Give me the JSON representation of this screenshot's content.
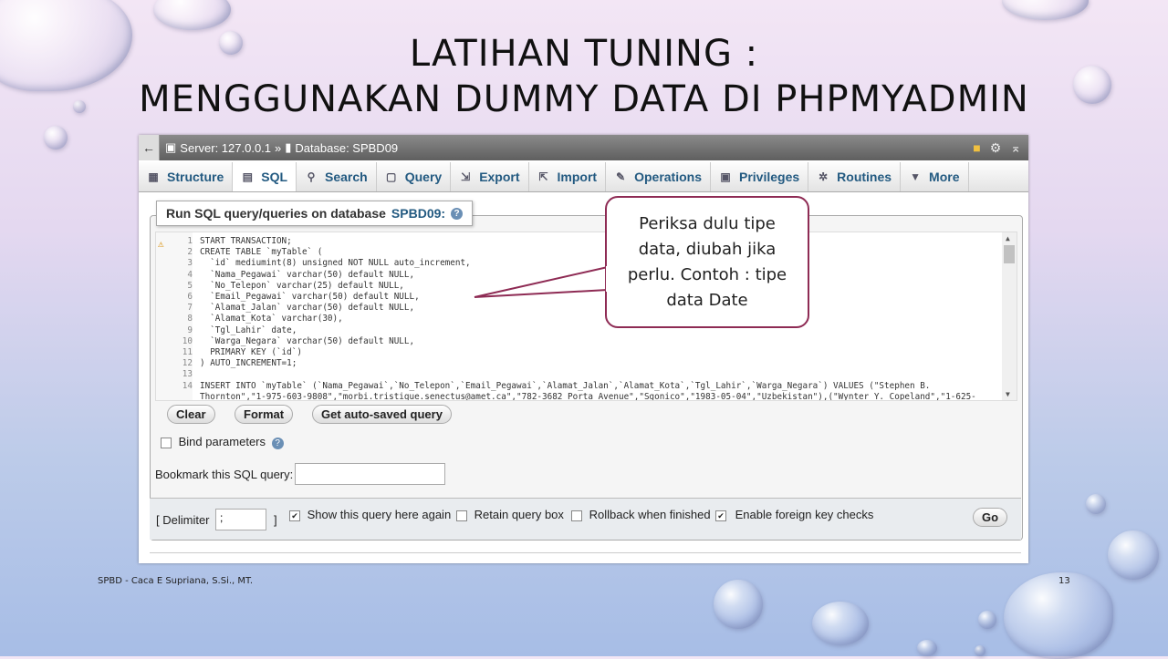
{
  "slide": {
    "title_line1": "LATIHAN TUNING :",
    "title_line2": "MENGGUNAKAN DUMMY DATA DI PHPMYADMIN",
    "footer_left": "SPBD - Caca E Supriana, S.Si., MT.",
    "page_number": "13"
  },
  "callout": {
    "line1": "Periksa dulu tipe",
    "line2": "data, diubah jika",
    "line3": "perlu. Contoh : tipe",
    "line4": "data Date"
  },
  "topbar": {
    "back": "←",
    "server": "Server: 127.0.0.1",
    "separator": "»",
    "database": "Database: SPBD09"
  },
  "tabs": [
    {
      "label": "Structure",
      "icon": "structure-icon"
    },
    {
      "label": "SQL",
      "icon": "sql-icon"
    },
    {
      "label": "Search",
      "icon": "search-icon"
    },
    {
      "label": "Query",
      "icon": "query-icon"
    },
    {
      "label": "Export",
      "icon": "export-icon"
    },
    {
      "label": "Import",
      "icon": "import-icon"
    },
    {
      "label": "Operations",
      "icon": "wrench-icon"
    },
    {
      "label": "Privileges",
      "icon": "privileges-icon"
    },
    {
      "label": "Routines",
      "icon": "routines-icon"
    },
    {
      "label": "More",
      "icon": "caret-down-icon"
    }
  ],
  "active_tab": "SQL",
  "sql_panel": {
    "legend_prefix": "Run SQL query/queries on database",
    "legend_db": "SPBD09:",
    "help": "?"
  },
  "editor_lines": [
    {
      "n": "1",
      "code": "START TRANSACTION;"
    },
    {
      "n": "2",
      "code": "CREATE TABLE `myTable` ("
    },
    {
      "n": "3",
      "code": "  `id` mediumint(8) unsigned NOT NULL auto_increment,"
    },
    {
      "n": "4",
      "code": "  `Nama_Pegawai` varchar(50) default NULL,"
    },
    {
      "n": "5",
      "code": "  `No_Telepon` varchar(25) default NULL,"
    },
    {
      "n": "6",
      "code": "  `Email_Pegawai` varchar(50) default NULL,"
    },
    {
      "n": "7",
      "code": "  `Alamat_Jalan` varchar(50) default NULL,"
    },
    {
      "n": "8",
      "code": "  `Alamat_Kota` varchar(30),"
    },
    {
      "n": "9",
      "code": "  `Tgl_Lahir` date,"
    },
    {
      "n": "10",
      "code": "  `Warga_Negara` varchar(50) default NULL,"
    },
    {
      "n": "11",
      "code": "  PRIMARY KEY (`id`)"
    },
    {
      "n": "12",
      "code": ") AUTO_INCREMENT=1;"
    },
    {
      "n": "13",
      "code": ""
    },
    {
      "n": "14",
      "code": "INSERT INTO `myTable` (`Nama_Pegawai`,`No_Telepon`,`Email_Pegawai`,`Alamat_Jalan`,`Alamat_Kota`,`Tgl_Lahir`,`Warga_Negara`) VALUES (\"Stephen B."
    },
    {
      "n": "",
      "code": "Thornton\",\"1-975-603-9808\",\"morbi.tristique.senectus@amet.ca\",\"782-3682 Porta Avenue\",\"Sgonico\",\"1983-05-04\",\"Uzbekistan\"),(\"Wynter Y. Copeland\",\"1-625-"
    }
  ],
  "buttons": {
    "clear": "Clear",
    "format": "Format",
    "autosaved": "Get auto-saved query",
    "go": "Go"
  },
  "bind_parameters": "Bind parameters",
  "bookmark_label": "Bookmark this SQL query:",
  "bookmark_value": "",
  "options": {
    "delimiter_label_open": "[ Delimiter",
    "delimiter_value": ";",
    "delimiter_label_close": "]",
    "show_query": "Show this query here again",
    "show_query_checked": true,
    "retain_box": "Retain query box",
    "retain_box_checked": false,
    "rollback": "Rollback when finished",
    "rollback_checked": false,
    "foreign_key": "Enable foreign key checks",
    "foreign_key_checked": true
  },
  "colors": {
    "accent": "#235a81",
    "callout_border": "#8e2b54"
  }
}
